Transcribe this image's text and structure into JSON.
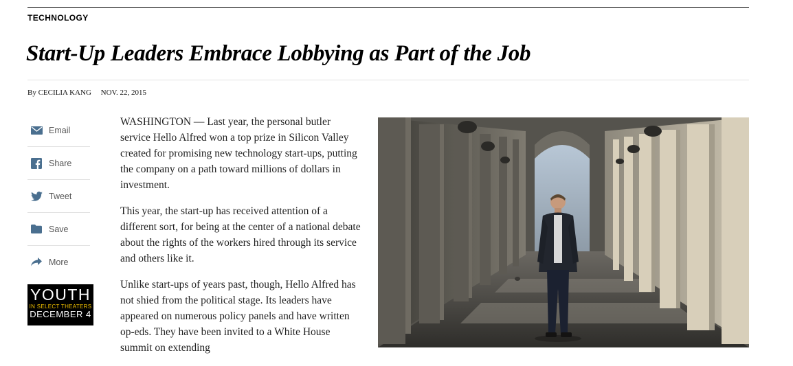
{
  "article": {
    "section": "TECHNOLOGY",
    "headline": "Start-Up Leaders Embrace Lobbying as Part of the Job",
    "byline": "By CECILIA KANG",
    "date": "NOV. 22, 2015",
    "paragraphs": [
      "WASHINGTON — Last year, the personal butler service Hello Alfred won a top prize in Silicon Valley created for promising new technology start-ups, putting the company on a path toward millions of dollars in investment.",
      "This year, the start-up has received attention of a different sort, for being at the center of a national debate about the rights of the workers hired through its service and others like it.",
      "Unlike start-ups of years past, though, Hello Alfred has not shied from the political stage. Its leaders have appeared on numerous policy panels and have written op-eds. They have been invited to a White House summit on extending"
    ]
  },
  "share_tools": [
    {
      "label": "Email",
      "icon": "envelope-icon"
    },
    {
      "label": "Share",
      "icon": "facebook-icon"
    },
    {
      "label": "Tweet",
      "icon": "twitter-icon"
    },
    {
      "label": "Save",
      "icon": "folder-icon"
    },
    {
      "label": "More",
      "icon": "share-arrow-icon"
    }
  ],
  "ad": {
    "title": "YOUTH",
    "subtitle": "IN SELECT THEATERS",
    "date": "DECEMBER 4"
  },
  "colors": {
    "share_icon": "#4a6f8f",
    "share_text": "#555555",
    "ad_subtitle": "#f0c000"
  }
}
